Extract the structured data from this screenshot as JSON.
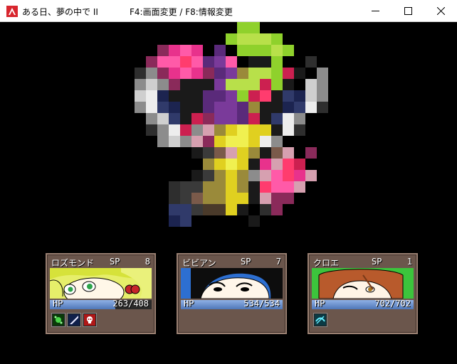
{
  "window": {
    "title": "ある日、夢の中で II",
    "hint": "F4:画面変更 / F8:情報変更",
    "buttons": [
      "minimize",
      "maximize",
      "close"
    ]
  },
  "enemy": {
    "icon": "pixelated-flower-monster-icon"
  },
  "party": [
    {
      "name": "ロズモンド",
      "sp_label": "SP",
      "sp": "8",
      "hp_label": "HP",
      "hp": "263/408",
      "hp_fraction": 0.645,
      "portrait_bg": "#cfe04a",
      "states": [
        "poison-icon",
        "blade-icon",
        "skull-icon"
      ]
    },
    {
      "name": "ビビアン",
      "sp_label": "SP",
      "sp": "7",
      "hp_label": "HP",
      "hp": "534/534",
      "hp_fraction": 1.0,
      "portrait_bg": "#2d6fd1",
      "states": []
    },
    {
      "name": "クロエ",
      "sp_label": "SP",
      "sp": "1",
      "hp_label": "HP",
      "hp": "702/702",
      "hp_fraction": 1.0,
      "portrait_bg": "#3cc43c",
      "states": [
        "blind-icon"
      ]
    }
  ]
}
